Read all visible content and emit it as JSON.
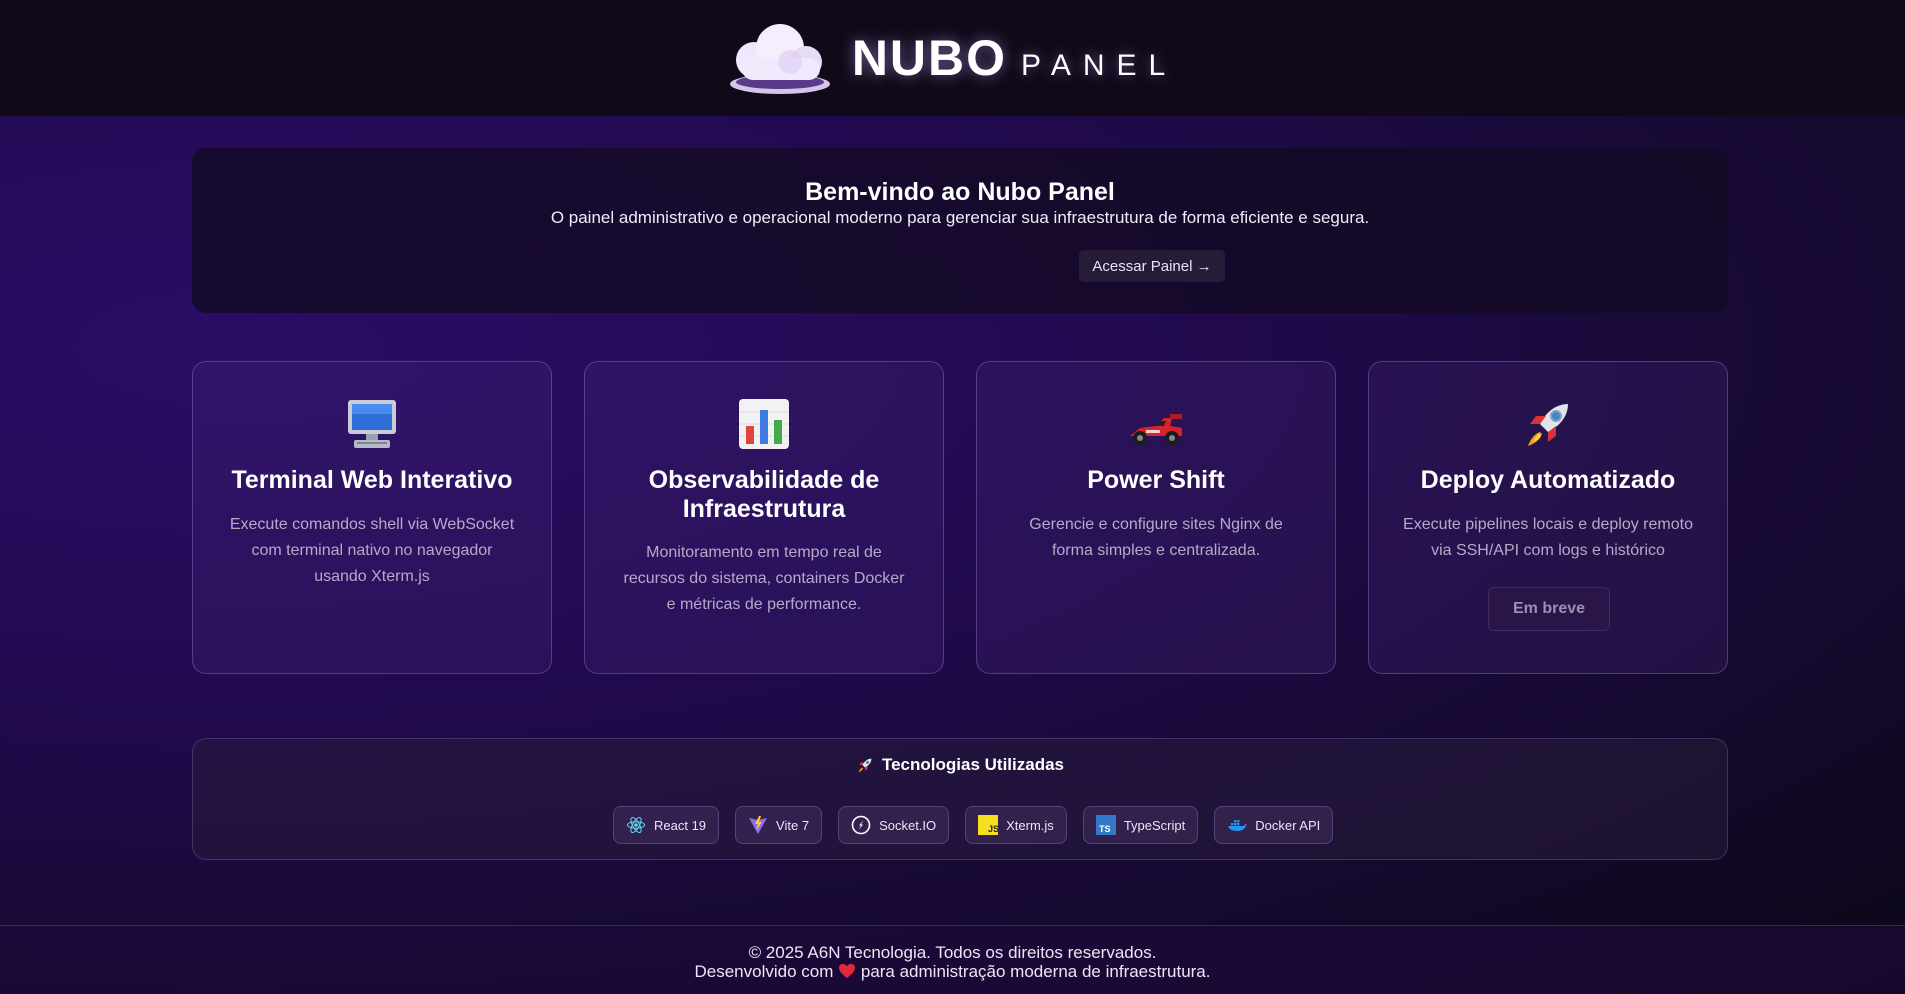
{
  "header": {
    "logo_word": "NUBO",
    "logo_suffix": "PANEL"
  },
  "hero": {
    "title": "Bem-vindo ao Nubo Panel",
    "subtitle": "O painel administrativo e operacional moderno para gerenciar sua infraestrutura de forma eficiente e segura.",
    "button_label": "Acessar Painel →"
  },
  "features": [
    {
      "icon": "desktop-computer-icon",
      "title": "Terminal Web Interativo",
      "description": "Execute comandos shell via WebSocket com terminal nativo no navegador usando Xterm.js"
    },
    {
      "icon": "bar-chart-icon",
      "title": "Observabilidade de Infraestrutura",
      "description": "Monitoramento em tempo real de recursos do sistema, containers Docker e métricas de performance."
    },
    {
      "icon": "racing-car-icon",
      "title": "Power Shift",
      "description": "Gerencie e configure sites Nginx de forma simples e centralizada."
    },
    {
      "icon": "rocket-icon",
      "title": "Deploy Automatizado",
      "description": "Execute pipelines locais e deploy remoto via SSH/API com logs e histórico",
      "button_label": "Em breve"
    }
  ],
  "technologies": {
    "title": "Tecnologias Utilizadas",
    "title_icon": "rocket-icon",
    "items": [
      {
        "label": "React 19",
        "icon": "react-icon"
      },
      {
        "label": "Vite 7",
        "icon": "vite-icon"
      },
      {
        "label": "Socket.IO",
        "icon": "socketio-icon"
      },
      {
        "label": "Xterm.js",
        "icon": "javascript-icon"
      },
      {
        "label": "TypeScript",
        "icon": "typescript-icon"
      },
      {
        "label": "Docker API",
        "icon": "docker-icon"
      }
    ]
  },
  "footer": {
    "copyright": "© 2025 A6N Tecnologia. Todos os direitos reservados.",
    "made_with_prefix": "Desenvolvido com",
    "made_with_suffix": "para administração moderna de infraestrutura.",
    "heart_icon": "heart-icon"
  },
  "colors": {
    "background_dark": "#100a18",
    "background_purple": "#2b0d66",
    "heart": "#e02b3c",
    "accent": "#a98ce6"
  }
}
